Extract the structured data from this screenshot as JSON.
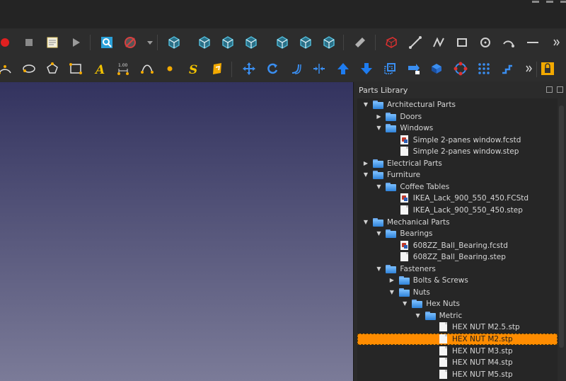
{
  "panel": {
    "title": "Parts Library"
  },
  "toolbar1": [
    {
      "icon": "record-macro-icon",
      "color": "#e02020"
    },
    {
      "icon": "stop-macro-icon",
      "color": "#8a8a8a"
    },
    {
      "icon": "macro-editor-icon",
      "color": "#e8d070"
    },
    {
      "icon": "execute-macro-icon",
      "color": "#9a9a9a"
    },
    {
      "icon": "zoom-icon",
      "color": "#2aa0d8"
    },
    {
      "icon": "draw-style-icon",
      "color": "#d84040"
    },
    {
      "icon": "dropdown-arrow-icon",
      "color": "#9a9a9a"
    },
    {
      "icon": "isometric-view-icon",
      "color": "#4fb7d4"
    },
    {
      "icon": "front-view-icon",
      "color": "#4fb7d4"
    },
    {
      "icon": "top-view-icon",
      "color": "#4fb7d4"
    },
    {
      "icon": "right-view-icon",
      "color": "#4fb7d4"
    },
    {
      "icon": "rear-view-icon",
      "color": "#4fb7d4"
    },
    {
      "icon": "bottom-view-icon",
      "color": "#4fb7d4"
    },
    {
      "icon": "left-view-icon",
      "color": "#4fb7d4"
    },
    {
      "icon": "measure-icon",
      "color": "#b0b0b0"
    },
    {
      "icon": "wire-cube-icon",
      "color": "#e03030"
    },
    {
      "icon": "line-icon",
      "color": "#d0d0d0"
    },
    {
      "icon": "polyline-icon",
      "color": "#d0d0d0"
    },
    {
      "icon": "rectangle-icon",
      "color": "#d0d0d0"
    },
    {
      "icon": "circle-icon",
      "color": "#d0d0d0"
    },
    {
      "icon": "arc-icon",
      "color": "#d0d0d0"
    },
    {
      "icon": "dimension-line-icon",
      "color": "#d0d0d0"
    }
  ],
  "toolbar2": [
    {
      "icon": "arc-tool-icon",
      "color": "#f2a900"
    },
    {
      "icon": "ellipse-icon",
      "color": "#f2a900"
    },
    {
      "icon": "polygon-icon",
      "color": "#f2a900"
    },
    {
      "icon": "rectangle-tool-icon",
      "color": "#f2a900"
    },
    {
      "icon": "text-icon",
      "color": "#f2c200"
    },
    {
      "icon": "dimension-icon",
      "color": "#f2a900"
    },
    {
      "icon": "bspline-icon",
      "color": "#f2a900"
    },
    {
      "icon": "point-icon",
      "color": "#f2a900"
    },
    {
      "icon": "shape-string-icon",
      "color": "#f2c200"
    },
    {
      "icon": "facebinder-icon",
      "color": "#f2a900"
    },
    {
      "icon": "move-icon",
      "color": "#3a8ef0"
    },
    {
      "icon": "rotate-icon",
      "color": "#3a8ef0"
    },
    {
      "icon": "offset-icon",
      "color": "#3a8ef0"
    },
    {
      "icon": "trimex-icon",
      "color": "#3a8ef0"
    },
    {
      "icon": "upgrade-icon",
      "color": "#1e7cf0"
    },
    {
      "icon": "downgrade-icon",
      "color": "#1e7cf0"
    },
    {
      "icon": "scale-icon",
      "color": "#3a8ef0"
    },
    {
      "icon": "draft-to-sketch-icon",
      "color": "#3a8ef0"
    },
    {
      "icon": "shape-2d-view-icon",
      "color": "#3a8ef0"
    },
    {
      "icon": "array-icon",
      "color": "#e03030"
    },
    {
      "icon": "point-array-icon",
      "color": "#3a8ef0"
    },
    {
      "icon": "working-plane-icon",
      "color": "#3a8ef0"
    },
    {
      "icon": "lock-icon",
      "color": "#f2a900"
    }
  ],
  "tree": [
    {
      "level": 0,
      "arrow": "open",
      "type": "folder",
      "label": "Architectural Parts"
    },
    {
      "level": 1,
      "arrow": "closed",
      "type": "folder",
      "label": "Doors"
    },
    {
      "level": 1,
      "arrow": "open",
      "type": "folder",
      "label": "Windows"
    },
    {
      "level": 2,
      "arrow": "none",
      "type": "fcstd",
      "label": "Simple 2-panes window.fcstd"
    },
    {
      "level": 2,
      "arrow": "none",
      "type": "file",
      "label": "Simple 2-panes window.step"
    },
    {
      "level": 0,
      "arrow": "closed",
      "type": "folder",
      "label": "Electrical Parts"
    },
    {
      "level": 0,
      "arrow": "open",
      "type": "folder",
      "label": "Furniture"
    },
    {
      "level": 1,
      "arrow": "open",
      "type": "folder",
      "label": "Coffee Tables"
    },
    {
      "level": 2,
      "arrow": "none",
      "type": "fcstd",
      "label": "IKEA_Lack_900_550_450.FCStd"
    },
    {
      "level": 2,
      "arrow": "none",
      "type": "file",
      "label": "IKEA_Lack_900_550_450.step"
    },
    {
      "level": 0,
      "arrow": "open",
      "type": "folder",
      "label": "Mechanical Parts"
    },
    {
      "level": 1,
      "arrow": "open",
      "type": "folder",
      "label": "Bearings"
    },
    {
      "level": 2,
      "arrow": "none",
      "type": "fcstd",
      "label": "608ZZ_Ball_Bearing.fcstd"
    },
    {
      "level": 2,
      "arrow": "none",
      "type": "file",
      "label": "608ZZ_Ball_Bearing.step"
    },
    {
      "level": 1,
      "arrow": "open",
      "type": "folder",
      "label": "Fasteners"
    },
    {
      "level": 2,
      "arrow": "closed",
      "type": "folder",
      "label": "Bolts & Screws"
    },
    {
      "level": 2,
      "arrow": "open",
      "type": "folder",
      "label": "Nuts"
    },
    {
      "level": 3,
      "arrow": "open",
      "type": "folder",
      "label": "Hex Nuts"
    },
    {
      "level": 4,
      "arrow": "open",
      "type": "folder",
      "label": "Metric"
    },
    {
      "level": 5,
      "arrow": "none",
      "type": "file",
      "label": "HEX NUT M2.5.stp"
    },
    {
      "level": 5,
      "arrow": "none",
      "type": "file",
      "label": "HEX NUT M2.stp",
      "selected": true
    },
    {
      "level": 5,
      "arrow": "none",
      "type": "file",
      "label": "HEX NUT M3.stp"
    },
    {
      "level": 5,
      "arrow": "none",
      "type": "file",
      "label": "HEX NUT M4.stp"
    },
    {
      "level": 5,
      "arrow": "none",
      "type": "file",
      "label": "HEX NUT M5.stp"
    }
  ]
}
